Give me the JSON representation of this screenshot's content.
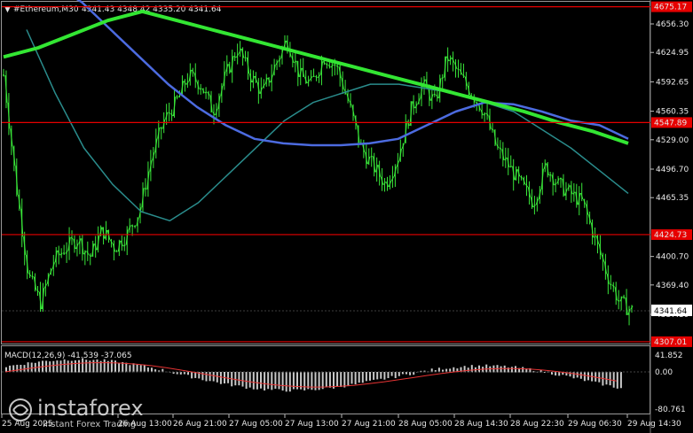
{
  "header": {
    "symbol": "#Ethereum,M30",
    "ohlc": "4341.43 4348.42 4335.20 4341.64"
  },
  "price_axis": {
    "ticks": [
      "4656.30",
      "4624.95",
      "4592.65",
      "4560.35",
      "4529.00",
      "4496.70",
      "4465.35",
      "4400.70",
      "4369.40",
      "4337.10"
    ]
  },
  "levels": [
    {
      "label": "4675.17",
      "value": 4675.17
    },
    {
      "label": "4547.89",
      "value": 4547.89
    },
    {
      "label": "4424.73",
      "value": 4424.73
    },
    {
      "label": "4307.01",
      "value": 4307.01
    }
  ],
  "current_price": {
    "label": "4341.64",
    "value": 4341.64
  },
  "macd": {
    "title": "MACD(12,26,9) -41.539 -37.065",
    "ticks": [
      "41.852",
      "0.00",
      "-80.761"
    ]
  },
  "time_axis": {
    "labels": [
      "25 Aug 2025",
      "26 Aug 13:00",
      "26 Aug 21:00",
      "27 Aug 05:00",
      "27 Aug 13:00",
      "27 Aug 21:00",
      "28 Aug 05:00",
      "28 Aug 14:30",
      "28 Aug 22:30",
      "29 Aug 06:30",
      "29 Aug 14:30"
    ]
  },
  "watermark": {
    "brand": "instaforex",
    "tagline": "Instant Forex Trading"
  },
  "colors": {
    "candle": "#39e639",
    "ma_fast": "#2a8c8c",
    "ma_mid": "#4c6be0",
    "ma_slow": "#33e633",
    "level": "#e60000",
    "macd_hist": "#c8c8c8",
    "macd_signal": "#e63333"
  },
  "chart_data": {
    "type": "candlestick",
    "symbol": "#Ethereum",
    "timeframe": "M30",
    "x": [
      "25 Aug 2025",
      "26 Aug 13:00",
      "26 Aug 21:00",
      "27 Aug 05:00",
      "27 Aug 13:00",
      "27 Aug 21:00",
      "28 Aug 05:00",
      "28 Aug 14:30",
      "28 Aug 22:30",
      "29 Aug 06:30",
      "29 Aug 14:30"
    ],
    "close_path": [
      4600,
      4480,
      4380,
      4350,
      4395,
      4410,
      4420,
      4400,
      4430,
      4410,
      4425,
      4450,
      4510,
      4550,
      4570,
      4600,
      4590,
      4560,
      4600,
      4630,
      4600,
      4580,
      4610,
      4640,
      4600,
      4590,
      4620,
      4610,
      4570,
      4520,
      4500,
      4480,
      4510,
      4560,
      4590,
      4570,
      4620,
      4600,
      4580,
      4560,
      4520,
      4500,
      4480,
      4460,
      4500,
      4480,
      4470,
      4460,
      4420,
      4380,
      4350,
      4341.64
    ],
    "ma_fast": [
      4650,
      4580,
      4520,
      4480,
      4450,
      4440,
      4460,
      4490,
      4520,
      4550,
      4570,
      4580,
      4590,
      4590,
      4585,
      4580,
      4570,
      4560,
      4540,
      4520,
      4495,
      4470
    ],
    "ma_mid": [
      4700,
      4680,
      4650,
      4620,
      4590,
      4565,
      4545,
      4530,
      4525,
      4523,
      4523,
      4525,
      4530,
      4545,
      4560,
      4570,
      4568,
      4560,
      4550,
      4545,
      4530
    ],
    "ma_slow": [
      4620,
      4630,
      4645,
      4660,
      4670,
      4660,
      4650,
      4640,
      4630,
      4620,
      4610,
      4600,
      4590,
      4580,
      4570,
      4560,
      4548,
      4538,
      4525
    ],
    "ylim": [
      4300,
      4690
    ]
  }
}
